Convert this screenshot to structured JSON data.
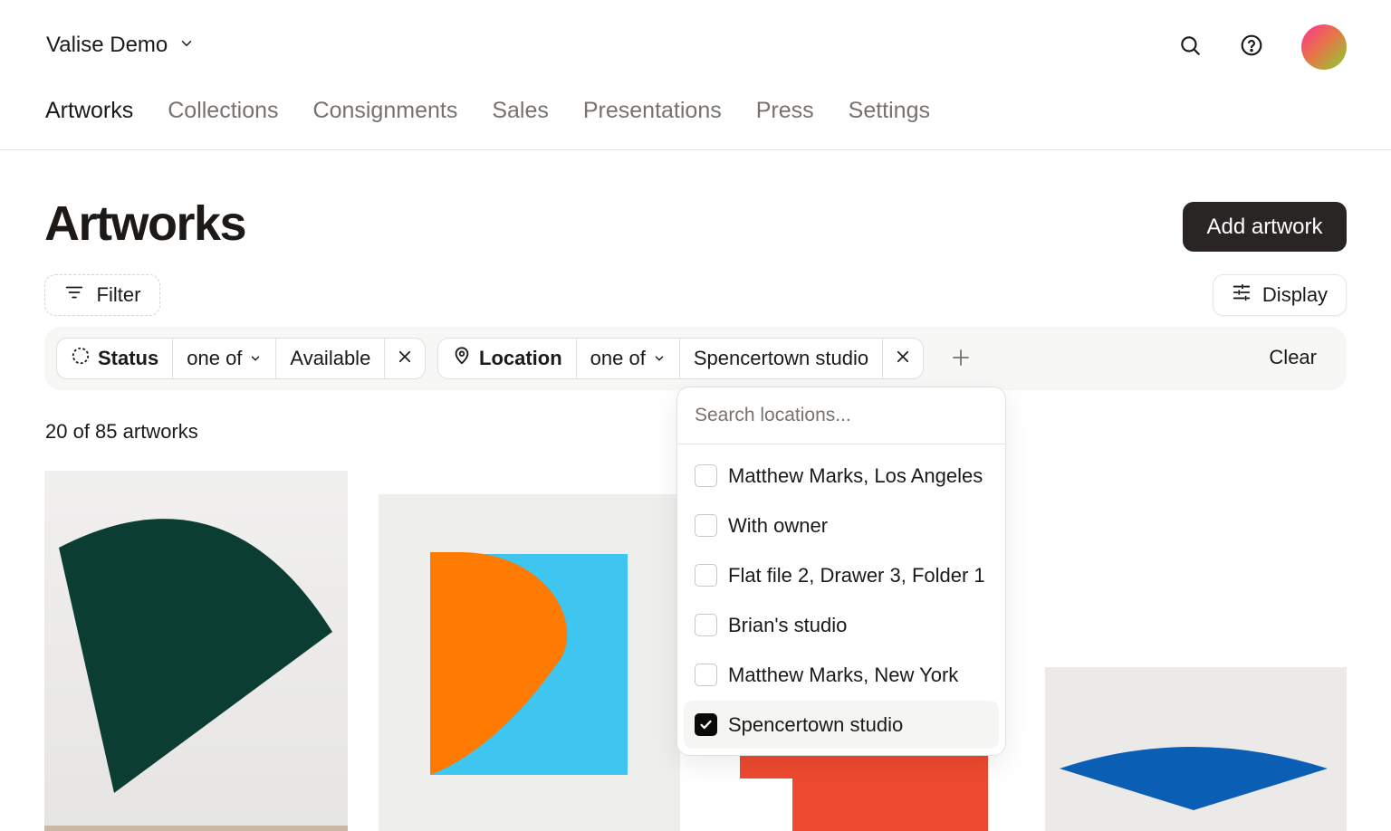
{
  "workspace": {
    "name": "Valise Demo",
    "icon": "chevron-down-icon"
  },
  "header_icons": [
    "search-icon",
    "help-icon",
    "avatar"
  ],
  "nav": {
    "tabs": [
      {
        "label": "Artworks",
        "active": true
      },
      {
        "label": "Collections",
        "active": false
      },
      {
        "label": "Consignments",
        "active": false
      },
      {
        "label": "Sales",
        "active": false
      },
      {
        "label": "Presentations",
        "active": false
      },
      {
        "label": "Press",
        "active": false
      },
      {
        "label": "Settings",
        "active": false
      }
    ]
  },
  "page": {
    "title": "Artworks",
    "add_button": "Add artwork",
    "filter_button": "Filter",
    "display_button": "Display",
    "count_text": "20 of 85 artworks"
  },
  "filters": {
    "status": {
      "label": "Status",
      "operator": "one of",
      "value": "Available"
    },
    "location": {
      "label": "Location",
      "operator": "one of",
      "value": "Spencertown studio"
    },
    "clear_label": "Clear"
  },
  "location_dropdown": {
    "placeholder": "Search locations...",
    "options": [
      {
        "label": "Matthew Marks, Los Angeles",
        "checked": false
      },
      {
        "label": "With owner",
        "checked": false
      },
      {
        "label": "Flat file 2, Drawer 3, Folder 1",
        "checked": false
      },
      {
        "label": "Brian's studio",
        "checked": false
      },
      {
        "label": "Matthew Marks, New York",
        "checked": false
      },
      {
        "label": "Spencertown studio",
        "checked": true
      }
    ]
  },
  "colors": {
    "primary_button": "#292524",
    "text": "#1c1917",
    "muted_text": "#78716c",
    "artwork_green": "#0b3d33",
    "artwork_orange": "#ff7a00",
    "artwork_light_blue": "#40c8f0",
    "artwork_red": "#ee4a30",
    "artwork_blue": "#0a5fb5"
  }
}
